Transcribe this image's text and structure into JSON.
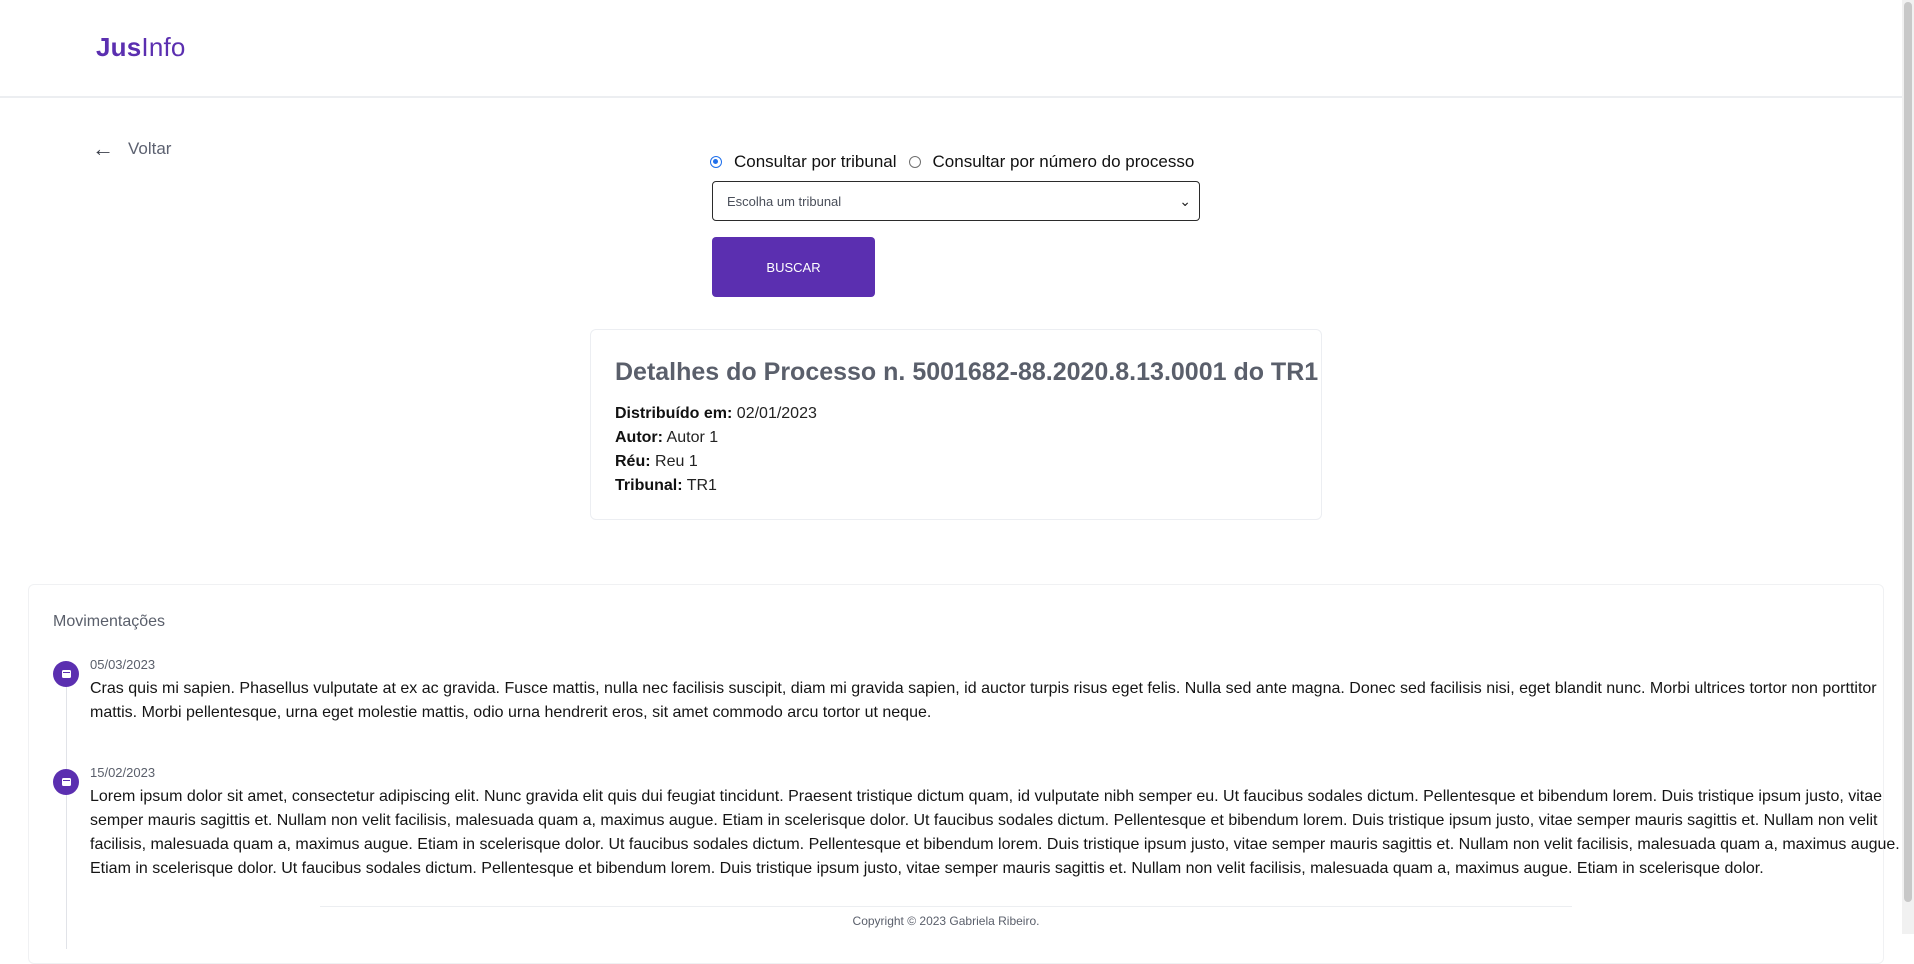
{
  "app": {
    "logo_strong": "Jus",
    "logo_rest": "Info"
  },
  "nav": {
    "back_label": "Voltar",
    "back_icon": "arrow-left-icon"
  },
  "search": {
    "radio_options": [
      {
        "label": "Consultar por tribunal",
        "checked": true
      },
      {
        "label": "Consultar por número do processo",
        "checked": false
      }
    ],
    "select_value": "Escolha um tribunal",
    "button_label": "BUSCAR"
  },
  "details": {
    "title": "Detalhes do Processo n. 5001682-88.2020.8.13.0001 do TR1",
    "fields": [
      {
        "label": "Distribuído em:",
        "value": "02/01/2023"
      },
      {
        "label": "Autor:",
        "value": "Autor 1"
      },
      {
        "label": "Réu:",
        "value": "Reu 1"
      },
      {
        "label": "Tribunal:",
        "value": "TR1"
      }
    ]
  },
  "movements": {
    "title": "Movimentações",
    "items": [
      {
        "date": "05/03/2023",
        "text": "Cras quis mi sapien. Phasellus vulputate at ex ac gravida. Fusce mattis, nulla nec facilisis suscipit, diam mi gravida sapien, id auctor turpis risus eget felis. Nulla sed ante magna. Donec sed facilisis nisi, eget blandit nunc. Morbi ultrices tortor non porttitor mattis. Morbi pellentesque, urna eget molestie mattis, odio urna hendrerit eros, sit amet commodo arcu tortor ut neque."
      },
      {
        "date": "15/02/2023",
        "text": "Lorem ipsum dolor sit amet, consectetur adipiscing elit. Nunc gravida elit quis dui feugiat tincidunt. Praesent tristique dictum quam, id vulputate nibh semper eu. Ut faucibus sodales dictum. Pellentesque et bibendum lorem. Duis tristique ipsum justo, vitae semper mauris sagittis et. Nullam non velit facilisis, malesuada quam a, maximus augue. Etiam in scelerisque dolor. Ut faucibus sodales dictum. Pellentesque et bibendum lorem. Duis tristique ipsum justo, vitae semper mauris sagittis et. Nullam non velit facilisis, malesuada quam a, maximus augue. Etiam in scelerisque dolor. Ut faucibus sodales dictum. Pellentesque et bibendum lorem. Duis tristique ipsum justo, vitae semper mauris sagittis et. Nullam non velit facilisis, malesuada quam a, maximus augue. Etiam in scelerisque dolor. Ut faucibus sodales dictum. Pellentesque et bibendum lorem. Duis tristique ipsum justo, vitae semper mauris sagittis et. Nullam non velit facilisis, malesuada quam a, maximus augue. Etiam in scelerisque dolor."
      }
    ]
  },
  "footer": {
    "copyright": "Copyright © 2023 Gabriela Ribeiro."
  },
  "colors": {
    "brand": "#5b2fb0",
    "radio_checked": "#1f6feb",
    "muted_text": "#5a5f6b"
  }
}
